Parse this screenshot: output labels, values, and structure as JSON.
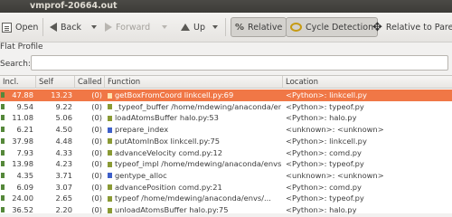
{
  "window": {
    "title": "vmprof-20664.out"
  },
  "toolbar": {
    "open_label": "Open",
    "back_label": "Back",
    "forward_label": "Forward",
    "up_label": "Up",
    "relative_label": "Relative",
    "cycle_label": "Cycle Detection",
    "relative_to_parent_label": "Relative to Parent",
    "relative_icon_text": "%",
    "move_icon_text": "✥"
  },
  "view": {
    "section_label": "Flat Profile"
  },
  "search": {
    "label": "Search:",
    "value": "",
    "placeholder": ""
  },
  "table": {
    "columns": {
      "incl": "Incl.",
      "self": "Self",
      "called": "Called",
      "function": "Function",
      "location": "Location"
    },
    "rows": [
      {
        "incl": "47.88",
        "self": "13.23",
        "called": "(0)",
        "function": "getBoxFromCoord linkcell.py:69",
        "location": "<Python>: linkcell.py",
        "kind": "python",
        "selected": true
      },
      {
        "incl": "9.54",
        "self": "9.22",
        "called": "(0)",
        "function": "_typeof_buffer /home/mdewing/anaconda/envs/...",
        "location": "<Python>: typeof.py",
        "kind": "python",
        "selected": false
      },
      {
        "incl": "11.08",
        "self": "5.06",
        "called": "(0)",
        "function": "loadAtomsBuffer halo.py:53",
        "location": "<Python>: halo.py",
        "kind": "python",
        "selected": false
      },
      {
        "incl": "6.21",
        "self": "4.50",
        "called": "(0)",
        "function": "prepare_index",
        "location": "<unknown>: <unknown>",
        "kind": "native",
        "selected": false
      },
      {
        "incl": "37.98",
        "self": "4.48",
        "called": "(0)",
        "function": "putAtomInBox linkcell.py:75",
        "location": "<Python>: linkcell.py",
        "kind": "python",
        "selected": false
      },
      {
        "incl": "7.93",
        "self": "4.33",
        "called": "(0)",
        "function": "advanceVelocity comd.py:12",
        "location": "<Python>: comd.py",
        "kind": "python",
        "selected": false
      },
      {
        "incl": "13.98",
        "self": "4.23",
        "called": "(0)",
        "function": "typeof_impl /home/mdewing/anaconda/envs/...",
        "location": "<Python>: typeof.py",
        "kind": "python",
        "selected": false
      },
      {
        "incl": "4.35",
        "self": "3.71",
        "called": "(0)",
        "function": "gentype_alloc",
        "location": "<unknown>: <unknown>",
        "kind": "native",
        "selected": false
      },
      {
        "incl": "6.09",
        "self": "3.07",
        "called": "(0)",
        "function": "advancePosition comd.py:21",
        "location": "<Python>: comd.py",
        "kind": "python",
        "selected": false
      },
      {
        "incl": "24.00",
        "self": "2.65",
        "called": "(0)",
        "function": "typeof /home/mdewing/anaconda/envs/...",
        "location": "<Python>: typeof.py",
        "kind": "python",
        "selected": false
      },
      {
        "incl": "36.52",
        "self": "2.20",
        "called": "(0)",
        "function": "unloadAtomsBuffer halo.py:75",
        "location": "<Python>: halo.py",
        "kind": "python",
        "selected": false
      }
    ]
  },
  "colors": {
    "selection": "#f07746",
    "python_icon": "#8a9a34",
    "native_icon": "#3d5fc9",
    "bar": "#55883a"
  }
}
